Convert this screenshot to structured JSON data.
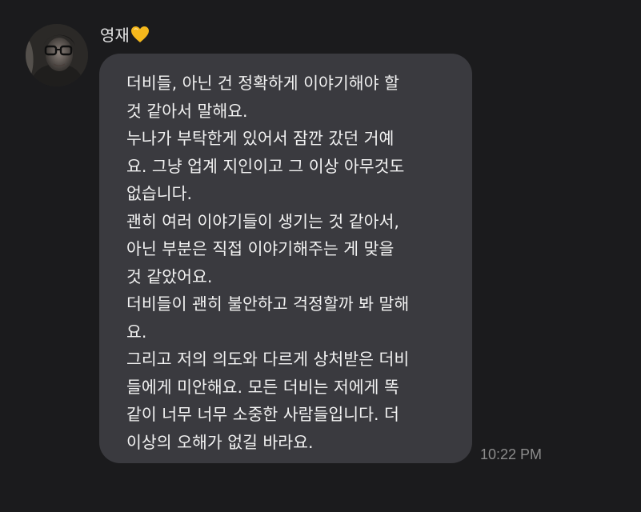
{
  "sender": {
    "name": "영재",
    "name_emoji": "yellow-heart-icon",
    "avatar": "profile-photo"
  },
  "message": {
    "lines": [
      "더비들, 아닌 건 정확하게 이야기해야 할",
      "것 같아서 말해요.",
      "누나가 부탁한게 있어서 잠깐 갔던 거예",
      "요. 그냥 업계 지인이고 그 이상 아무것도",
      "없습니다.",
      "괜히 여러 이야기들이 생기는 것 같아서,",
      "아닌 부분은 직접 이야기해주는 게 맞을",
      "것 같았어요.",
      "더비들이 괜히 불안하고 걱정할까 봐 말해",
      "요.",
      "그리고 저의 의도와 다르게 상처받은 더비",
      "들에게 미안해요. 모든 더비는 저에게 똑",
      "같이 너무 너무 소중한 사람들입니다. 더",
      "이상의 오해가 없길 바라요."
    ],
    "timestamp": "10:22 PM"
  },
  "colors": {
    "background": "#1b1b1d",
    "bubble": "#3a3a3f",
    "text": "#f2f2f2",
    "timestamp": "#8c8c8c",
    "heart": "#f5b81c"
  }
}
